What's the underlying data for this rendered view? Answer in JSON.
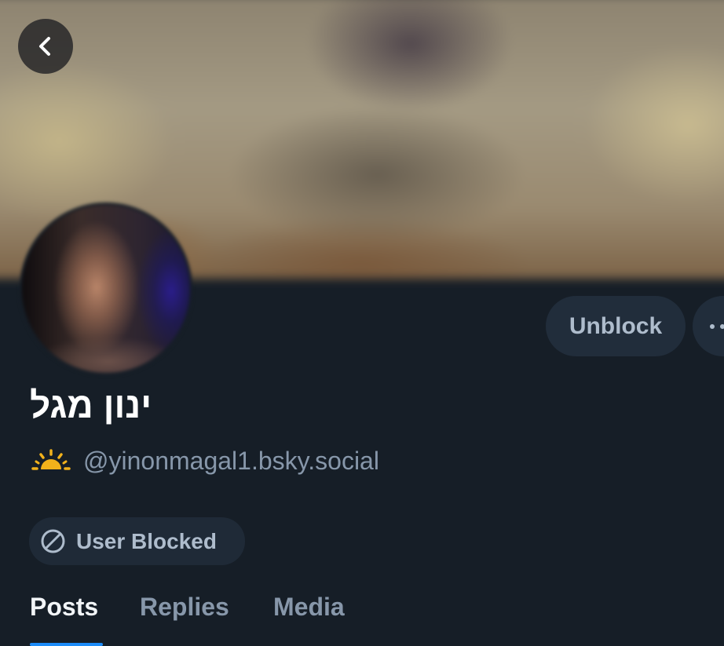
{
  "profile": {
    "display_name": "ינון מגל",
    "handle": "@yinonmagal1.bsky.social",
    "handle_badge_icon": "sunrise-icon",
    "status_badge": {
      "icon": "block-icon",
      "label": "User Blocked"
    }
  },
  "actions": {
    "back_icon": "chevron-left-icon",
    "unblock_label": "Unblock",
    "more_icon": "ellipsis-icon"
  },
  "tabs": [
    {
      "label": "Posts",
      "active": true
    },
    {
      "label": "Replies",
      "active": false
    },
    {
      "label": "Media",
      "active": false
    }
  ],
  "colors": {
    "background": "#161e27",
    "button_bg": "#212d3b",
    "muted_text": "#8797aa",
    "accent": "#1d8cf8",
    "sun_icon": "#f2b21b"
  }
}
